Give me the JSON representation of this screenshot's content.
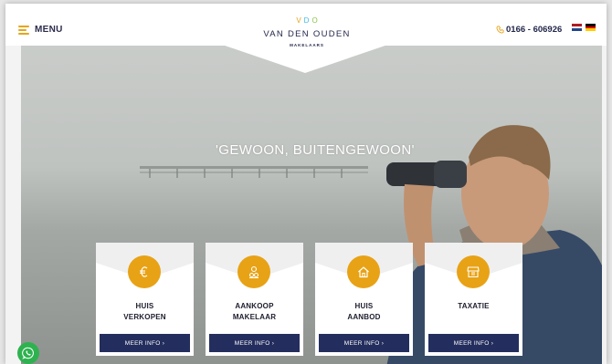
{
  "header": {
    "menu_label": "MENU",
    "logo_mark": [
      "V",
      "D",
      "O"
    ],
    "logo_mark_colors": [
      "#e8a215",
      "#43b7ea",
      "#8bc34a"
    ],
    "logo_name": "VAN DEN OUDEN",
    "logo_sub": "MAKELAARS",
    "phone": "0166 - 606926",
    "flags": [
      "dutch-flag",
      "german-flag"
    ]
  },
  "hero": {
    "title": "'GEWOON, BUITENGEWOON'"
  },
  "cards": [
    {
      "title": "HUIS\nVERKOPEN",
      "icon": "euro-icon",
      "button": "MEER INFO ›"
    },
    {
      "title": "AANKOOP\nMAKELAAR",
      "icon": "people-icon",
      "button": "MEER INFO ›"
    },
    {
      "title": "HUIS\nAANBOD",
      "icon": "house-icon",
      "button": "MEER INFO ›"
    },
    {
      "title": "TAXATIE",
      "icon": "shop-icon",
      "button": "MEER INFO ›"
    }
  ],
  "colors": {
    "accent": "#e8a215",
    "navy": "#242e5e",
    "whatsapp": "#2eb24f"
  }
}
